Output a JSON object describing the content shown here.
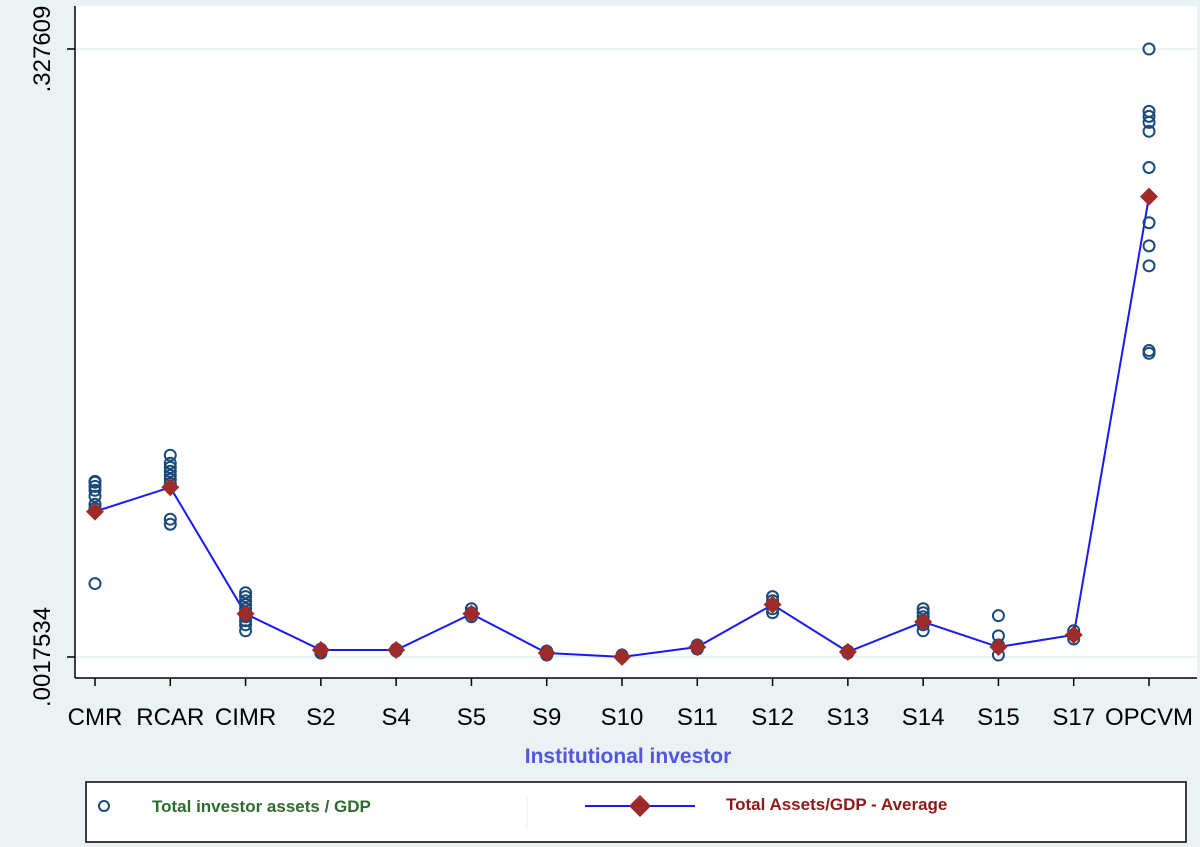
{
  "chart_data": {
    "type": "scatter",
    "title": "",
    "xlabel": "Institutional investor",
    "ylabel": "",
    "categories": [
      "CMR",
      "RCAR",
      "CIMR",
      "S2",
      "S4",
      "S5",
      "S9",
      "S10",
      "S11",
      "S12",
      "S13",
      "S14",
      "S15",
      "S17",
      "OPCVM"
    ],
    "y_ticks": [
      0.0017534,
      0.327609
    ],
    "y_tick_labels": [
      ".0017534",
      ".327609"
    ],
    "ylim": [
      0.0017534,
      0.327609
    ],
    "grid": true,
    "legend_position": "bottom",
    "series": [
      {
        "name": "Total investor assets / GDP",
        "type": "scatter",
        "marker": "hollow-circle",
        "color": "#1a4a7a",
        "points": [
          {
            "x": "CMR",
            "y": 0.0959
          },
          {
            "x": "CMR",
            "y": 0.0954
          },
          {
            "x": "CMR",
            "y": 0.0932
          },
          {
            "x": "CMR",
            "y": 0.0911
          },
          {
            "x": "CMR",
            "y": 0.0879
          },
          {
            "x": "CMR",
            "y": 0.0836
          },
          {
            "x": "CMR",
            "y": 0.0814
          },
          {
            "x": "CMR",
            "y": 0.0411
          },
          {
            "x": "RCAR",
            "y": 0.1099
          },
          {
            "x": "RCAR",
            "y": 0.1056
          },
          {
            "x": "RCAR",
            "y": 0.1034
          },
          {
            "x": "RCAR",
            "y": 0.1013
          },
          {
            "x": "RCAR",
            "y": 0.0991
          },
          {
            "x": "RCAR",
            "y": 0.097
          },
          {
            "x": "RCAR",
            "y": 0.0948
          },
          {
            "x": "RCAR",
            "y": 0.0756
          },
          {
            "x": "RCAR",
            "y": 0.0729
          },
          {
            "x": "CIMR",
            "y": 0.0362
          },
          {
            "x": "CIMR",
            "y": 0.0341
          },
          {
            "x": "CIMR",
            "y": 0.0319
          },
          {
            "x": "CIMR",
            "y": 0.0298
          },
          {
            "x": "CIMR",
            "y": 0.0276
          },
          {
            "x": "CIMR",
            "y": 0.0255
          },
          {
            "x": "CIMR",
            "y": 0.0233
          },
          {
            "x": "CIMR",
            "y": 0.0212
          },
          {
            "x": "CIMR",
            "y": 0.019
          },
          {
            "x": "CIMR",
            "y": 0.0158
          },
          {
            "x": "S2",
            "y": 0.006
          },
          {
            "x": "S2",
            "y": 0.0049
          },
          {
            "x": "S2",
            "y": 0.0039
          },
          {
            "x": "S4",
            "y": 0.006
          },
          {
            "x": "S4",
            "y": 0.0055
          },
          {
            "x": "S4",
            "y": 0.005
          },
          {
            "x": "S5",
            "y": 0.0276
          },
          {
            "x": "S5",
            "y": 0.0255
          },
          {
            "x": "S5",
            "y": 0.0233
          },
          {
            "x": "S9",
            "y": 0.0049
          },
          {
            "x": "S9",
            "y": 0.0039
          },
          {
            "x": "S9",
            "y": 0.0028
          },
          {
            "x": "S10",
            "y": 0.0028
          },
          {
            "x": "S10",
            "y": 0.0018
          },
          {
            "x": "S11",
            "y": 0.0082
          },
          {
            "x": "S11",
            "y": 0.0071
          },
          {
            "x": "S11",
            "y": 0.006
          },
          {
            "x": "S12",
            "y": 0.0341
          },
          {
            "x": "S12",
            "y": 0.0319
          },
          {
            "x": "S12",
            "y": 0.0298
          },
          {
            "x": "S12",
            "y": 0.0276
          },
          {
            "x": "S12",
            "y": 0.0255
          },
          {
            "x": "S13",
            "y": 0.005
          },
          {
            "x": "S13",
            "y": 0.0039
          },
          {
            "x": "S14",
            "y": 0.0276
          },
          {
            "x": "S14",
            "y": 0.0255
          },
          {
            "x": "S14",
            "y": 0.0233
          },
          {
            "x": "S14",
            "y": 0.0212
          },
          {
            "x": "S14",
            "y": 0.019
          },
          {
            "x": "S14",
            "y": 0.0158
          },
          {
            "x": "S15",
            "y": 0.0239
          },
          {
            "x": "S15",
            "y": 0.0131
          },
          {
            "x": "S15",
            "y": 0.0082
          },
          {
            "x": "S15",
            "y": 0.0028
          },
          {
            "x": "S17",
            "y": 0.0158
          },
          {
            "x": "S17",
            "y": 0.0136
          },
          {
            "x": "S17",
            "y": 0.0114
          },
          {
            "x": "OPCVM",
            "y": 0.3276
          },
          {
            "x": "OPCVM",
            "y": 0.2942
          },
          {
            "x": "OPCVM",
            "y": 0.2915
          },
          {
            "x": "OPCVM",
            "y": 0.2883
          },
          {
            "x": "OPCVM",
            "y": 0.2835
          },
          {
            "x": "OPCVM",
            "y": 0.2641
          },
          {
            "x": "OPCVM",
            "y": 0.2345
          },
          {
            "x": "OPCVM",
            "y": 0.2221
          },
          {
            "x": "OPCVM",
            "y": 0.2114
          },
          {
            "x": "OPCVM",
            "y": 0.166
          },
          {
            "x": "OPCVM",
            "y": 0.1645
          }
        ]
      },
      {
        "name": "Total Assets/GDP - Average",
        "type": "line",
        "marker": "diamond",
        "line_color": "#1a1aee",
        "marker_color": "#9e2a2a",
        "values": [
          0.0797,
          0.0927,
          0.0249,
          0.0055,
          0.0055,
          0.0249,
          0.0039,
          0.0018,
          0.0071,
          0.0298,
          0.0045,
          0.0206,
          0.0071,
          0.0136,
          0.2485
        ]
      }
    ]
  },
  "legend": {
    "items": [
      {
        "label": "Total investor assets / GDP",
        "color": "#2e6b2e"
      },
      {
        "label": "Total Assets/GDP - Average",
        "color": "#8b1a1a"
      }
    ]
  }
}
